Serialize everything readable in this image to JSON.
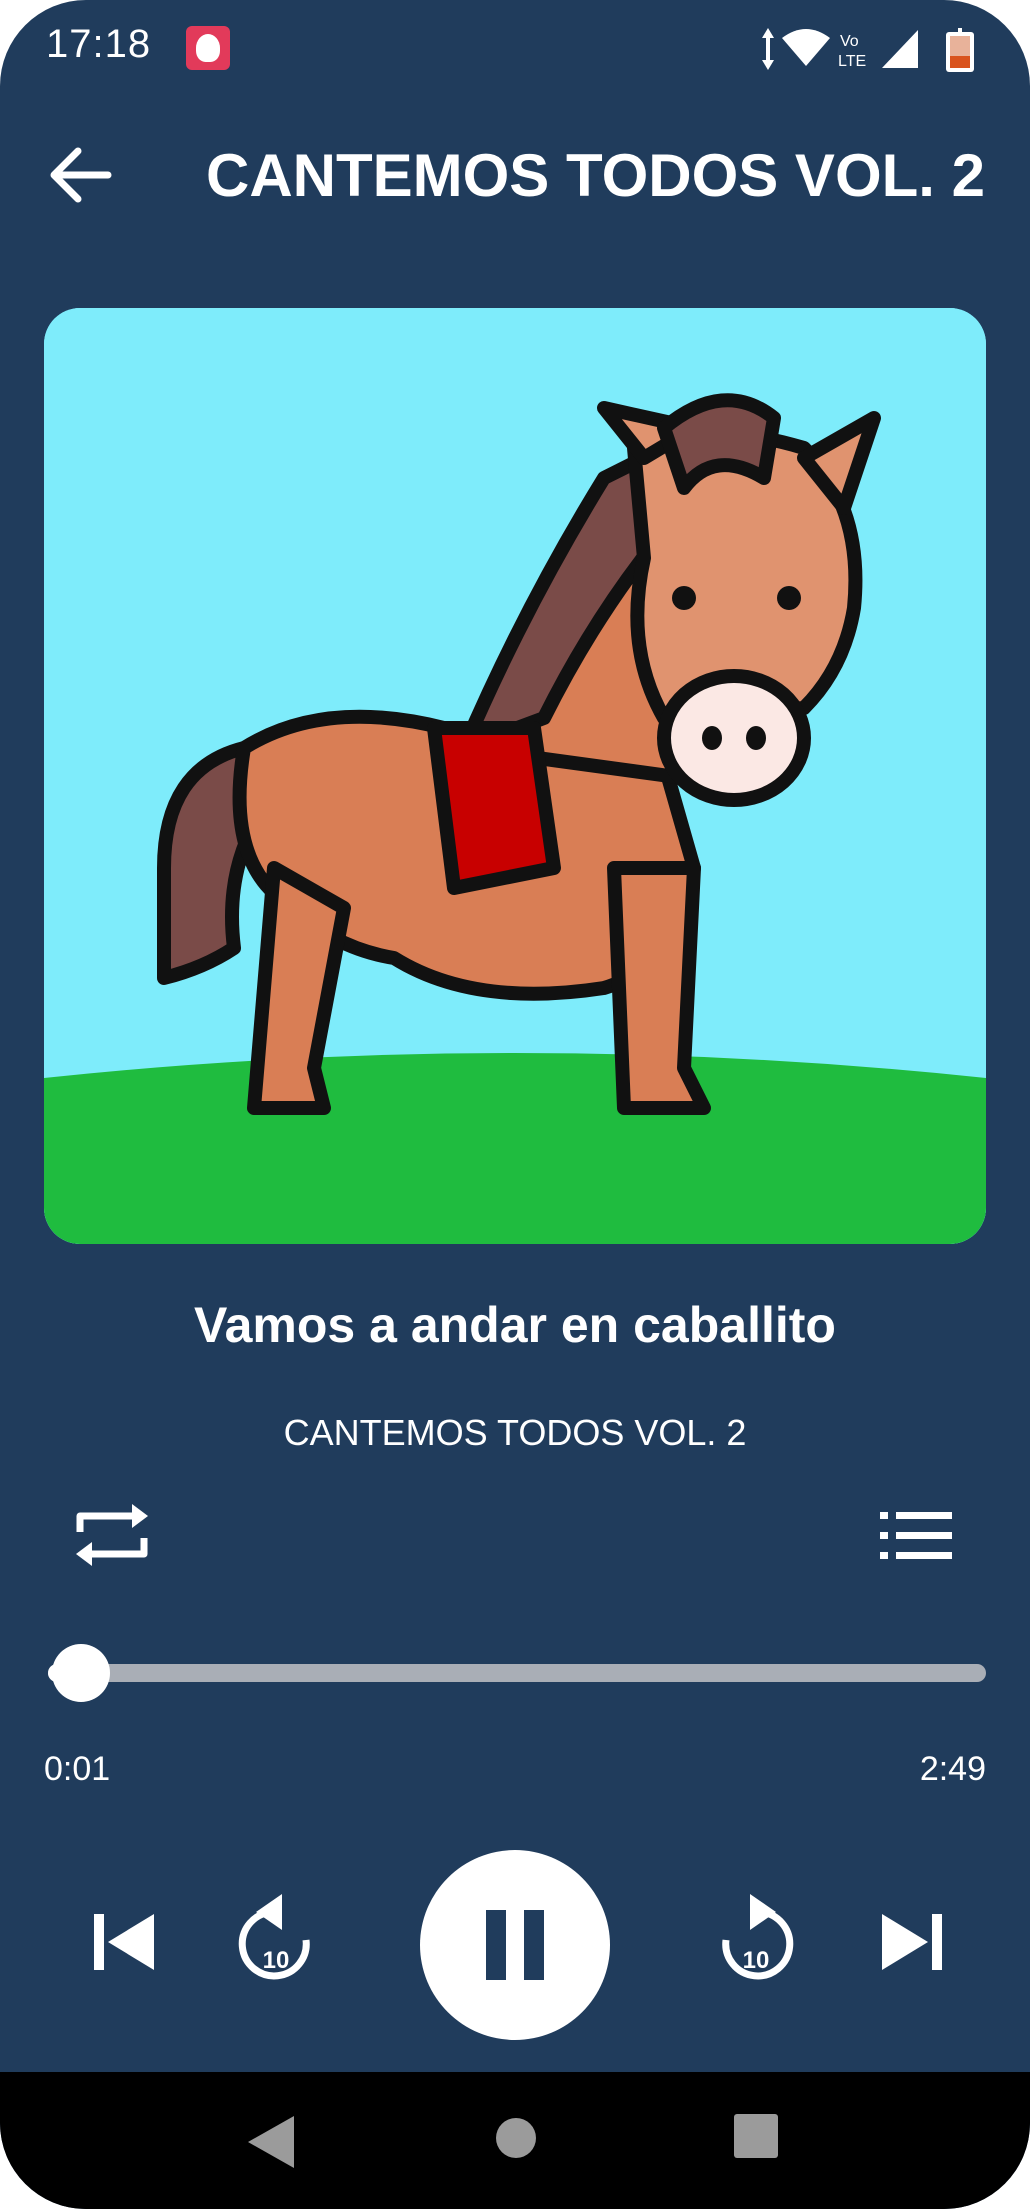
{
  "status_bar": {
    "time": "17:18",
    "icons": [
      "app-notification-icon",
      "data-arrows-icon",
      "wifi-icon",
      "volte-icon",
      "signal-icon",
      "battery-icon"
    ],
    "volte_label_top": "Vo",
    "volte_label_bottom": "LTE"
  },
  "header": {
    "title": "CANTEMOS TODOS VOL. 2",
    "back_icon": "arrow-left-icon"
  },
  "artwork": {
    "description_icon": "horse-illustration",
    "colors": {
      "sky": "#7eecfb",
      "grass": "#1fbc3f",
      "horse": "#d97e55",
      "mane": "#7a4b48",
      "saddle": "#c80000"
    }
  },
  "now_playing": {
    "title": "Vamos a andar en caballito",
    "album": "CANTEMOS TODOS VOL. 2"
  },
  "controls": {
    "repeat_icon": "repeat-icon",
    "queue_icon": "playlist-icon",
    "progress_fraction": 0.006,
    "time_current": "0:01",
    "time_total": "2:49",
    "rewind_label": "10",
    "forward_label": "10",
    "play_state": "playing"
  },
  "nav_bar": {
    "buttons": [
      "back-triangle-icon",
      "home-circle-icon",
      "recents-square-icon"
    ]
  },
  "theme": {
    "background": "#203c5c",
    "accent": "#ffffff"
  }
}
